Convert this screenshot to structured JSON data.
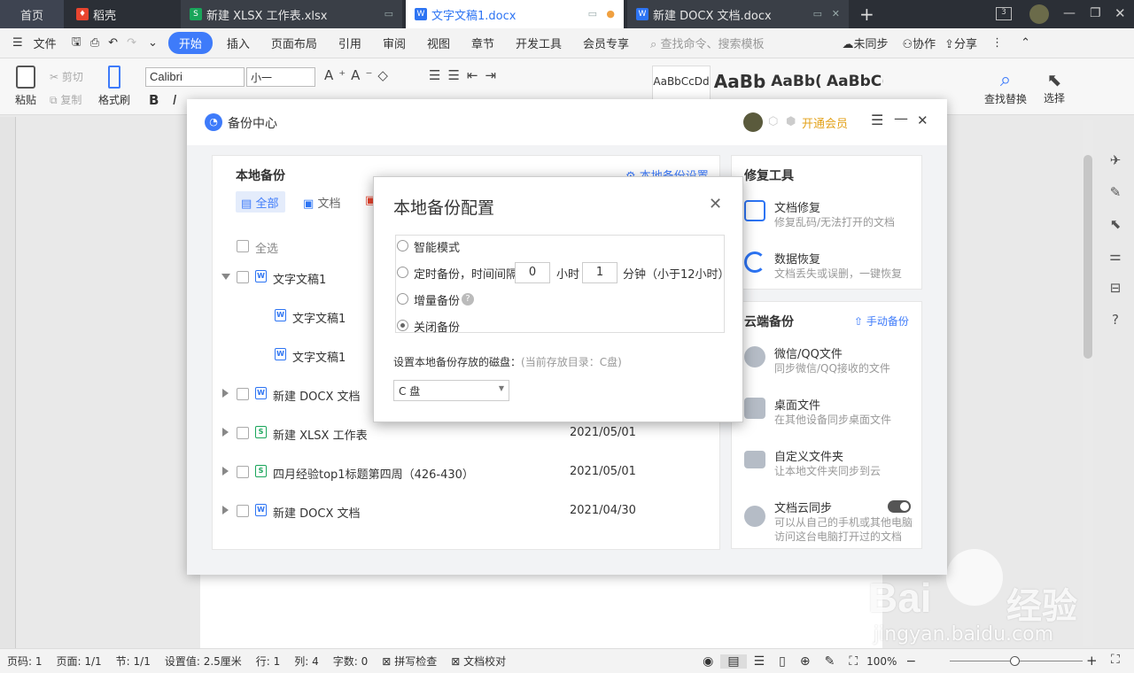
{
  "tabs": [
    {
      "label": "首页",
      "icon": "home-icon"
    },
    {
      "label": "稻壳",
      "icon": "docer-icon"
    },
    {
      "label": "新建 XLSX 工作表.xlsx",
      "icon": "sheet-icon"
    },
    {
      "label": "文字文稿1.docx",
      "icon": "doc-icon"
    },
    {
      "label": "新建 DOCX 文档.docx",
      "icon": "doc-icon"
    }
  ],
  "menu": {
    "file": "文件",
    "items": [
      "开始",
      "插入",
      "页面布局",
      "引用",
      "审阅",
      "视图",
      "章节",
      "开发工具",
      "会员专享"
    ],
    "search_placeholder": "查找命令、搜索模板",
    "sync": "未同步",
    "collab": "协作",
    "share": "分享"
  },
  "toolbar": {
    "paste": "粘贴",
    "cut": "剪切",
    "copy": "复制",
    "format_painter": "格式刷",
    "font": "Calibri",
    "size": "小一",
    "styles": [
      "AaBbCcDd",
      "AaBb",
      "AaBb(",
      "AaBbC("
    ],
    "find_replace": "查找替换",
    "select": "选择"
  },
  "backup_center": {
    "title": "备份中心",
    "member": "开通会员",
    "local_title": "本地备份",
    "local_settings": "本地备份设置",
    "filters": [
      "全部",
      "文档"
    ],
    "select_all": "全选",
    "files": [
      {
        "name": "文字文稿1",
        "date": "",
        "type": "doc",
        "expandable": true,
        "expanded": true,
        "indent": 0
      },
      {
        "name": "文字文稿1",
        "date": "",
        "type": "doc",
        "expandable": false,
        "expanded": false,
        "indent": 1
      },
      {
        "name": "文字文稿1",
        "date": "",
        "type": "doc",
        "expandable": false,
        "expanded": false,
        "indent": 1
      },
      {
        "name": "新建 DOCX 文档",
        "date": "",
        "type": "doc",
        "expandable": true,
        "expanded": false,
        "indent": 0
      },
      {
        "name": "新建 XLSX 工作表",
        "date": "2021/05/01",
        "type": "sheet",
        "expandable": true,
        "expanded": false,
        "indent": 0
      },
      {
        "name": "四月经验top1标题第四周（426-430）",
        "date": "2021/05/01",
        "type": "sheet",
        "expandable": true,
        "expanded": false,
        "indent": 0
      },
      {
        "name": "新建 DOCX 文档",
        "date": "2021/04/30",
        "type": "doc",
        "expandable": true,
        "expanded": false,
        "indent": 0
      }
    ],
    "repair_title": "修复工具",
    "repair": [
      {
        "title": "文档修复",
        "desc": "修复乱码/无法打开的文档",
        "icon": "doc-repair-icon"
      },
      {
        "title": "数据恢复",
        "desc": "文档丢失或误删，一键恢复",
        "icon": "data-recovery-icon"
      }
    ],
    "cloud_title": "云端备份",
    "manual_backup": "手动备份",
    "cloud": [
      {
        "title": "微信/QQ文件",
        "desc": "同步微信/QQ接收的文件",
        "icon": "chat-cloud-icon"
      },
      {
        "title": "桌面文件",
        "desc": "在其他设备同步桌面文件",
        "icon": "desktop-icon"
      },
      {
        "title": "自定义文件夹",
        "desc": "让本地文件夹同步到云",
        "icon": "folder-icon"
      },
      {
        "title": "文档云同步",
        "desc": "可以从自己的手机或其他电脑",
        "desc2": "访问这台电脑打开过的文档",
        "icon": "cloud-upload-icon"
      }
    ]
  },
  "modal": {
    "title": "本地备份配置",
    "options": [
      "智能模式",
      "定时备份，时间间隔",
      "增量备份",
      "关闭备份"
    ],
    "selected": 3,
    "hours_value": "0",
    "hours_unit": "小时",
    "minutes_value": "1",
    "minutes_unit": "分钟（小于12小时）",
    "disk_label": "设置本地备份存放的磁盘：",
    "disk_current": "(当前存放目录：C盘)",
    "disk_value": "C 盘"
  },
  "status": {
    "page_code": "页码: 1",
    "page": "页面: 1/1",
    "section": "节: 1/1",
    "setting": "设置值: 2.5厘米",
    "row": "行: 1",
    "col": "列: 4",
    "words": "字数: 0",
    "spell": "拼写检查",
    "proof": "文档校对",
    "zoom": "100%"
  },
  "watermark": {
    "text1": "Bai",
    "text2": "经验",
    "url": "jingyan.baidu.com"
  },
  "colors": {
    "accent": "#3e7bfa",
    "member": "#e3a21a",
    "doc_blue": "#2d74f3",
    "sheet_green": "#19a55a"
  }
}
